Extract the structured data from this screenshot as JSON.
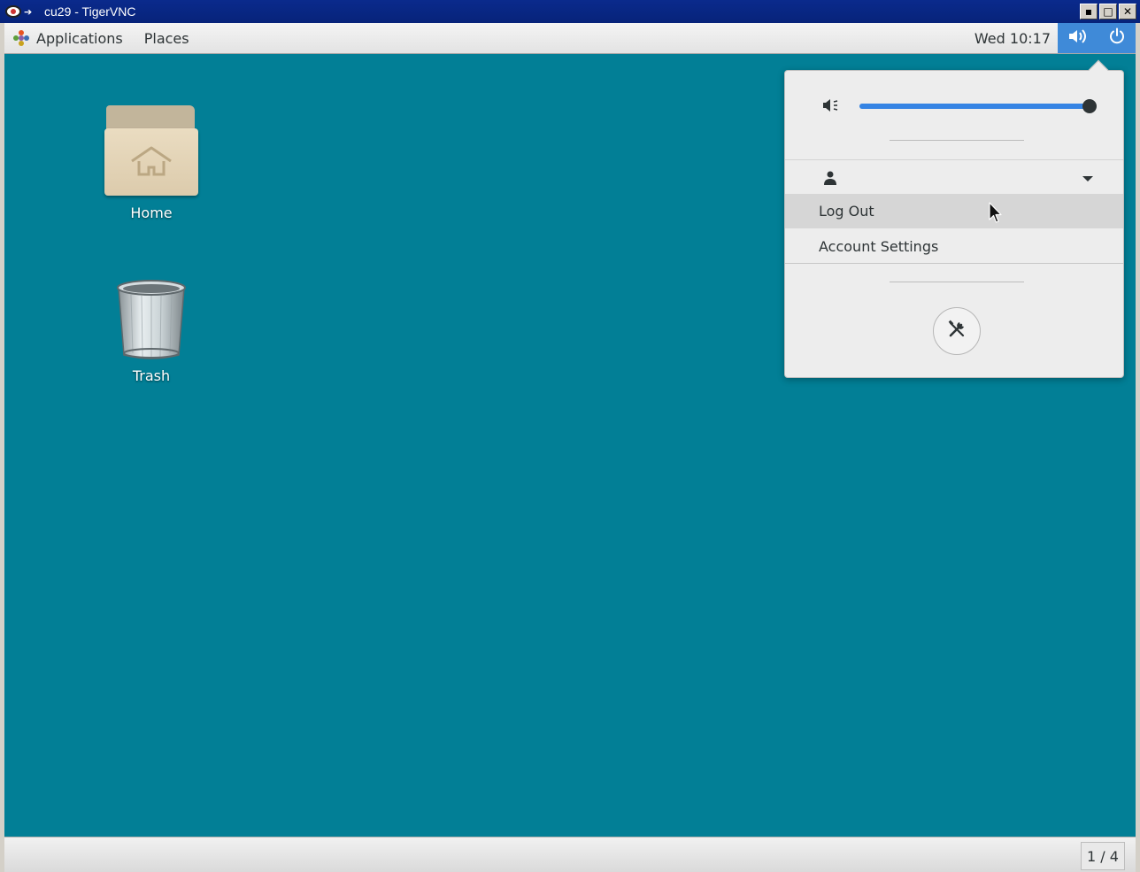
{
  "vnc_window": {
    "title": "cu29 - TigerVNC",
    "buttons": [
      "minimize",
      "maximize",
      "close"
    ]
  },
  "top_bar": {
    "applications_label": "Applications",
    "places_label": "Places",
    "clock": "Wed 10:17",
    "tray_icons": [
      "volume-icon",
      "power-icon"
    ],
    "tray_color": "#3f8ad8"
  },
  "desktop": {
    "background_color": "#027f96",
    "icons": [
      {
        "label": "Home",
        "icon": "home-folder-icon"
      },
      {
        "label": "Trash",
        "icon": "trash-icon"
      }
    ]
  },
  "status_menu": {
    "volume_level": 1.0,
    "volume_icon": "speaker-icon",
    "user_icon": "user-icon",
    "items": [
      {
        "label": "Log Out",
        "hovered": true
      },
      {
        "label": "Account Settings",
        "hovered": false
      }
    ],
    "settings_icon": "settings-tools-icon",
    "accent_color": "#3584e4"
  },
  "bottom_bar": {
    "workspace_indicator": "1 / 4"
  }
}
